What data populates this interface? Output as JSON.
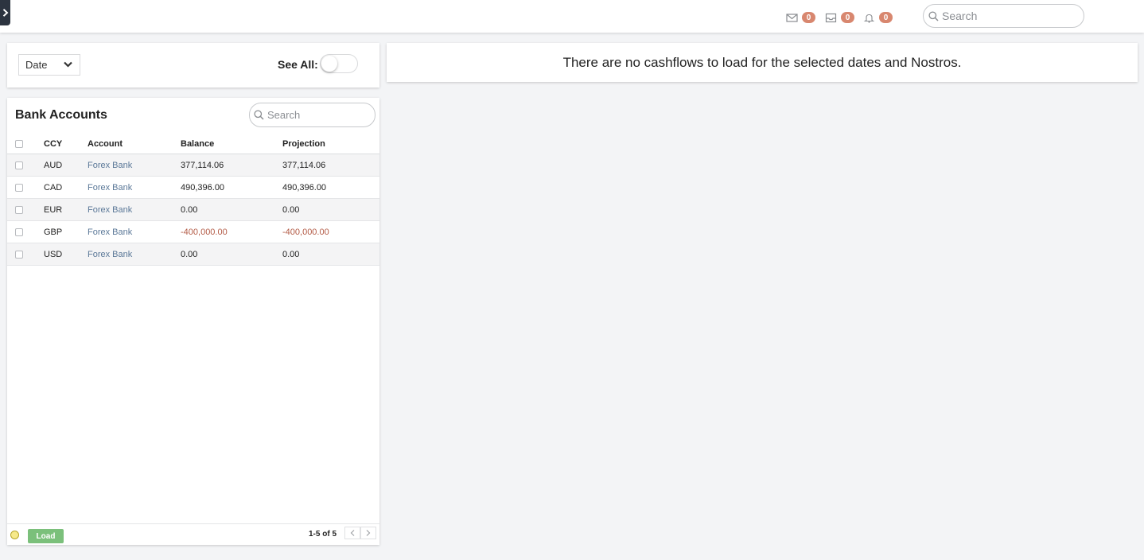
{
  "topbar": {
    "menu_icon": "chevron-right-icon",
    "notifications": [
      {
        "icon": "mail-icon",
        "count": "0"
      },
      {
        "icon": "inbox-icon",
        "count": "0"
      },
      {
        "icon": "bell-icon",
        "count": "0"
      }
    ],
    "search_placeholder": "Search"
  },
  "filter": {
    "date_label": "Date",
    "see_all_label": "See All:",
    "see_all_on": false
  },
  "message": "There are no cashflows to load for the selected dates and Nostros.",
  "accounts": {
    "title": "Bank Accounts",
    "search_placeholder": "Search",
    "columns": {
      "ccy": "CCY",
      "account": "Account",
      "balance": "Balance",
      "projection": "Projection"
    },
    "rows": [
      {
        "ccy": "AUD",
        "account": "Forex Bank",
        "balance": "377,114.06",
        "projection": "377,114.06"
      },
      {
        "ccy": "CAD",
        "account": "Forex Bank",
        "balance": "490,396.00",
        "projection": "490,396.00"
      },
      {
        "ccy": "EUR",
        "account": "Forex Bank",
        "balance": "0.00",
        "projection": "0.00"
      },
      {
        "ccy": "GBP",
        "account": "Forex Bank",
        "balance": "-400,000.00",
        "projection": "-400,000.00"
      },
      {
        "ccy": "USD",
        "account": "Forex Bank",
        "balance": "0.00",
        "projection": "0.00"
      }
    ],
    "footer": {
      "load_label": "Load",
      "pager_text": "1-5 of 5"
    }
  },
  "colors": {
    "badge": "#d8876f",
    "negative": "#b35b46",
    "link": "#5b7898",
    "load_button": "#7bc07b"
  }
}
